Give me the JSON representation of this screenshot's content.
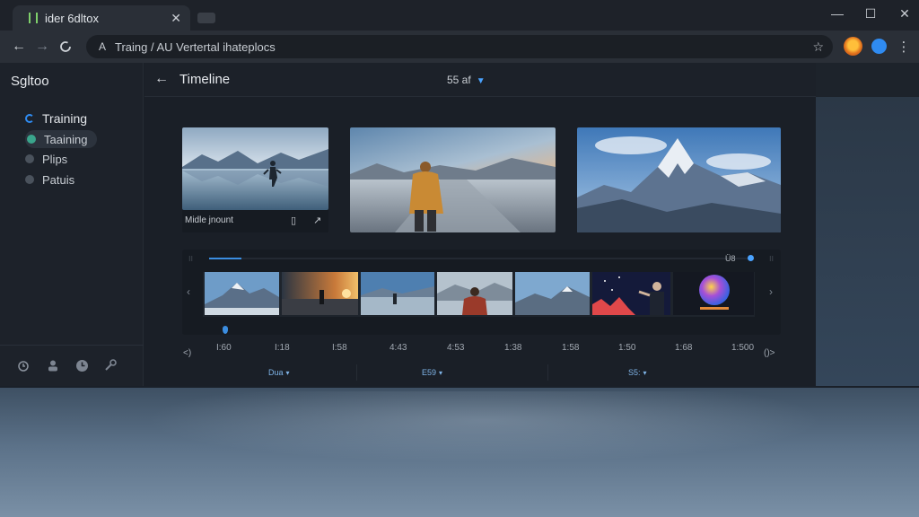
{
  "browser": {
    "tab_title": "ider 6dltox",
    "tab_close": "✕",
    "url": "Traing / AU Vertertal ihateplocs",
    "window_controls": {
      "minimize": "—",
      "maximize": "☐",
      "close": "✕"
    }
  },
  "sidebar": {
    "brand": "Sgltoo",
    "items": [
      {
        "label": "Training",
        "color": "#2f8bf1",
        "active": false
      },
      {
        "label": "Taaining",
        "color": "#3aa58c",
        "active": true
      },
      {
        "label": "Plips",
        "color": "#4a525c",
        "active": false
      },
      {
        "label": "Patuis",
        "color": "#4a525c",
        "active": false
      }
    ],
    "footer_icons": [
      "alarm-icon",
      "person-icon",
      "clock-icon",
      "tool-icon"
    ]
  },
  "header": {
    "title": "Timeline",
    "zoom_value": "55 af"
  },
  "previews": [
    {
      "caption": "Midle jnount"
    }
  ],
  "timeline": {
    "count_label": "Ü8",
    "progress": 0.06,
    "ticks": [
      "I:60",
      "I:18",
      "I:58",
      "4:43",
      "4:53",
      "1:38",
      "1:58",
      "1:50",
      "1:68",
      "1:500"
    ],
    "selectors": [
      "Dua",
      "E59",
      "S5:"
    ]
  },
  "colors": {
    "accent": "#3b8de0",
    "app_bg": "#1a1f27",
    "sidebar_bg": "#1d222a"
  }
}
